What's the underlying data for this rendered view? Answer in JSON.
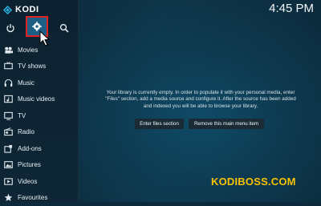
{
  "app": {
    "title": "KODI",
    "clock": "4:45 PM"
  },
  "topbar": {
    "icons": [
      "power-icon",
      "settings-icon",
      "search-icon"
    ]
  },
  "sidebar": {
    "items": [
      {
        "label": "Movies",
        "icon": "movie-icon"
      },
      {
        "label": "TV shows",
        "icon": "tv-show-icon"
      },
      {
        "label": "Music",
        "icon": "headphones-icon"
      },
      {
        "label": "Music videos",
        "icon": "music-video-icon"
      },
      {
        "label": "TV",
        "icon": "tv-icon"
      },
      {
        "label": "Radio",
        "icon": "radio-icon"
      },
      {
        "label": "Add-ons",
        "icon": "addons-icon"
      },
      {
        "label": "Pictures",
        "icon": "pictures-icon"
      },
      {
        "label": "Videos",
        "icon": "videos-icon"
      },
      {
        "label": "Favourites",
        "icon": "favourites-icon"
      }
    ]
  },
  "main": {
    "message_lines": [
      "Your library is currently empty. In order to populate it with your personal media, enter",
      "\"Files\" section, add a media source and configure it. After the source has been added",
      "and indexed you will be able to browse your library."
    ],
    "buttons": {
      "enter_files": "Enter files section",
      "remove_item": "Remove this main menu item"
    }
  },
  "watermark": "KODIBOSS.COM",
  "colors": {
    "highlight_border": "#e02424",
    "selected_bg": "#1f5f86",
    "watermark": "#f7c200"
  }
}
